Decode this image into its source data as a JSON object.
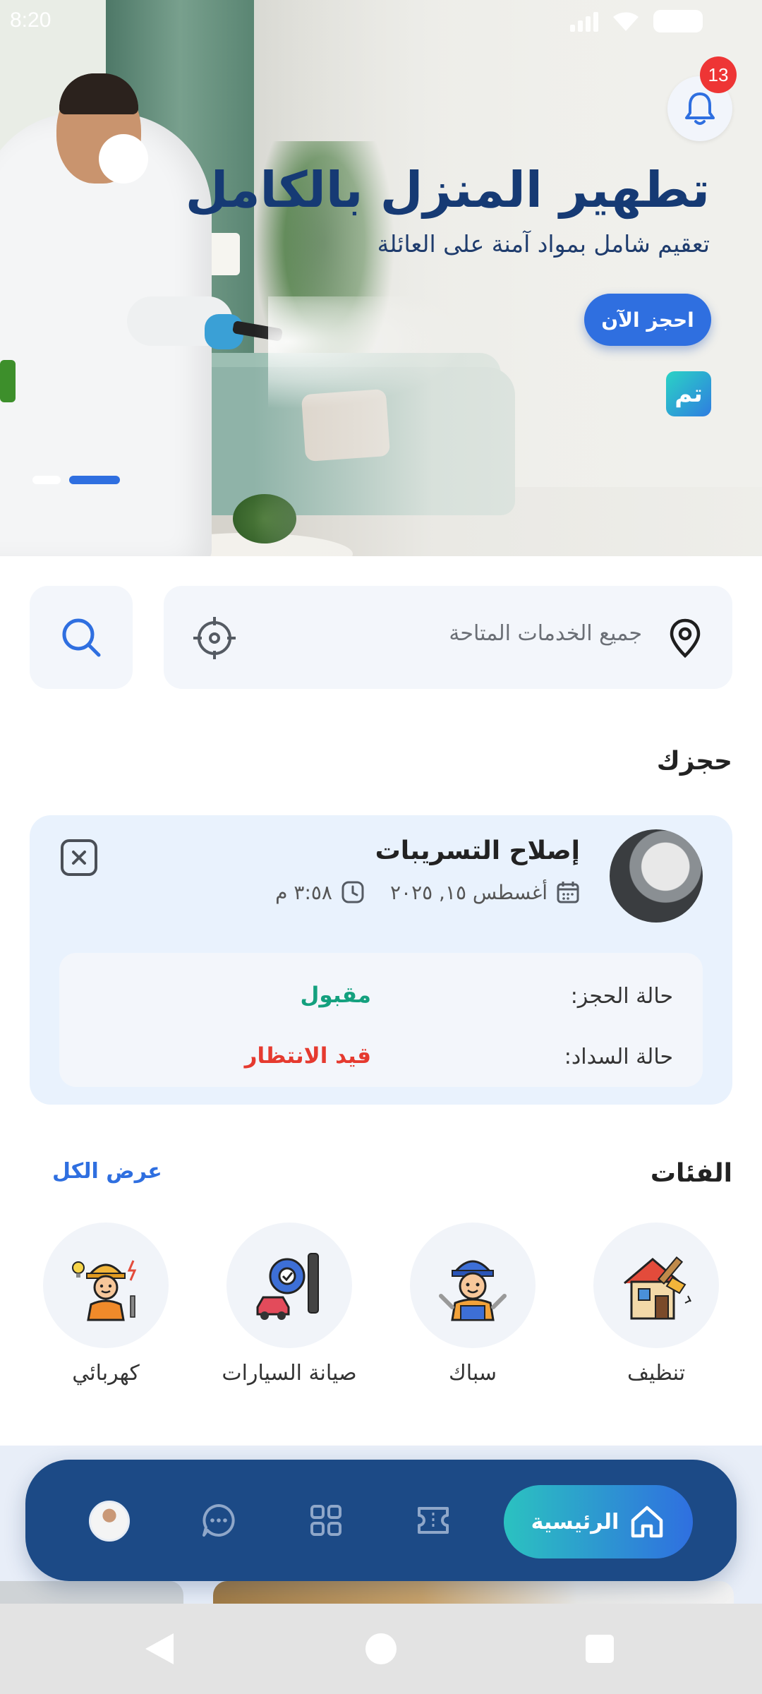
{
  "status_bar": {
    "time": "8:20"
  },
  "hero": {
    "title": "تطهير المنزل بالكامل",
    "subtitle": "تعقيم شامل بمواد آمنة على العائلة",
    "cta_label": "احجز الآن",
    "brand_logo_text": "تم",
    "notifications_count": "13",
    "slides_total": 2,
    "active_slide": 2
  },
  "search": {
    "placeholder": "جميع الخدمات المتاحة"
  },
  "booking": {
    "section_title": "حجزك",
    "service_name": "إصلاح التسريبات",
    "date": "أغسطس ١٥, ٢٠٢٥",
    "time": "٣:٥٨ م",
    "booking_status_label": "حالة الحجز:",
    "booking_status_value": "مقبول",
    "payment_status_label": "حالة السداد:",
    "payment_status_value": "قيد الانتظار",
    "colors": {
      "accepted": "#13a07e",
      "pending": "#e53a2f"
    }
  },
  "categories": {
    "section_title": "الفئات",
    "view_all_label": "عرض الكل",
    "items": [
      {
        "label": "تنظيف",
        "icon": "cleaning-icon"
      },
      {
        "label": "سباك",
        "icon": "plumber-icon"
      },
      {
        "label": "صيانة السيارات",
        "icon": "car-maintenance-icon"
      },
      {
        "label": "كهربائي",
        "icon": "electrician-icon"
      }
    ]
  },
  "bottom_nav": {
    "home_label": "الرئيسية",
    "items": [
      "home-icon",
      "ticket-icon",
      "grid-icon",
      "chat-icon",
      "profile-avatar"
    ]
  },
  "colors": {
    "primary": "#2f6fe0",
    "nav_bg": "#1c4a86",
    "title": "#163a74",
    "badge": "#ee3535"
  }
}
